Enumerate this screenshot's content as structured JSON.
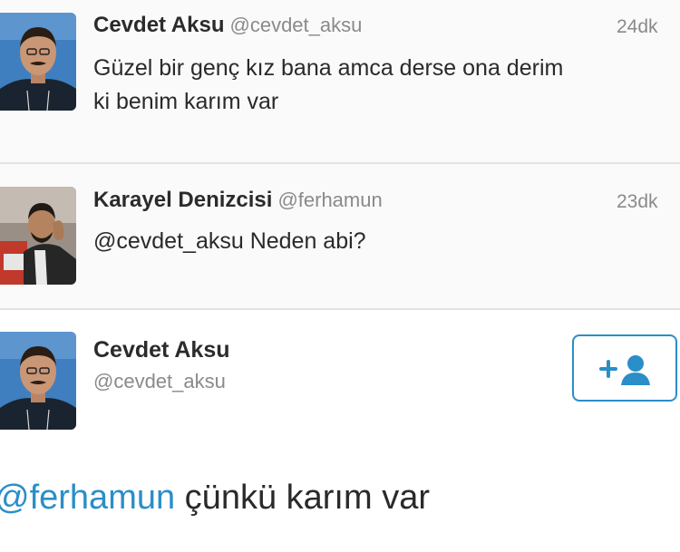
{
  "tweets": [
    {
      "name": "Cevdet Aksu",
      "handle": "@cevdet_aksu",
      "time": "24dk",
      "line1": "Güzel bir genç kız bana amca derse ona derim",
      "line2": "ki benim karım var"
    },
    {
      "name": "Karayel Denizcisi",
      "handle": "@ferhamun",
      "time": "23dk",
      "line1": "@cevdet_aksu Neden abi?"
    }
  ],
  "detail": {
    "name": "Cevdet Aksu",
    "handle": "@cevdet_aksu",
    "follow_icon": "add-user-icon",
    "reply_mention": "@ferhamun",
    "reply_body": " çünkü karım var"
  },
  "colors": {
    "accent": "#2a8ec8",
    "muted": "#8a8a8a",
    "row_bg": "#fafafa",
    "divider": "#e3e3e3"
  }
}
